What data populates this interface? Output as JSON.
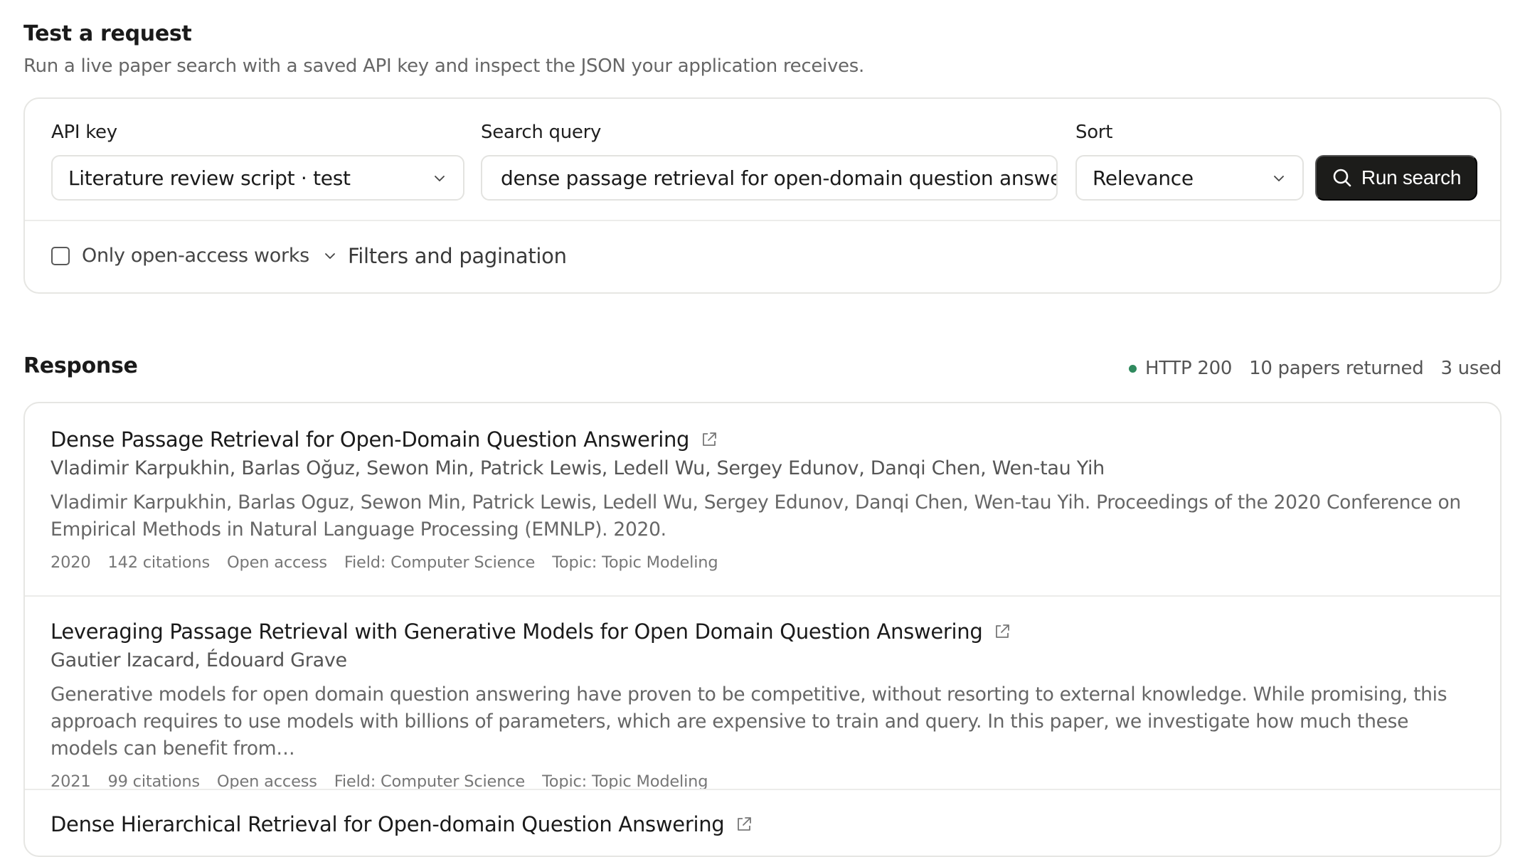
{
  "request": {
    "title": "Test a request",
    "subtitle": "Run a live paper search with a saved API key and inspect the JSON your application receives.",
    "api_key": {
      "label": "API key",
      "value": "Literature review script · test"
    },
    "query": {
      "label": "Search query",
      "value": "dense passage retrieval for open-domain question answering"
    },
    "sort": {
      "label": "Sort",
      "value": "Relevance"
    },
    "run_label": "Run search",
    "open_access_label": "Only open-access works",
    "open_access_checked": false,
    "filters_label": "Filters and pagination"
  },
  "response": {
    "title": "Response",
    "status": "HTTP 200",
    "returned": "10 papers returned",
    "used": "3 used",
    "status_color": "#2f8a5e",
    "results": [
      {
        "title": "Dense Passage Retrieval for Open-Domain Question Answering",
        "authors": "Vladimir Karpukhin, Barlas Oğuz, Sewon Min, Patrick Lewis, Ledell Wu, Sergey Edunov, Danqi Chen, Wen-tau Yih",
        "abstract": "Vladimir Karpukhin, Barlas Oguz, Sewon Min, Patrick Lewis, Ledell Wu, Sergey Edunov, Danqi Chen, Wen-tau Yih. Proceedings of the 2020 Conference on Empirical Methods in Natural Language Processing (EMNLP). 2020.",
        "year": "2020",
        "citations": "142 citations",
        "access": "Open access",
        "field": "Field: Computer Science",
        "topic": "Topic: Topic Modeling"
      },
      {
        "title": "Leveraging Passage Retrieval with Generative Models for Open Domain Question Answering",
        "authors": "Gautier Izacard, Édouard Grave",
        "abstract": "Generative models for open domain question answering have proven to be competitive, without resorting to external knowledge. While promising, this approach requires to use models with billions of parameters, which are expensive to train and query. In this paper, we investigate how much these models can benefit from…",
        "year": "2021",
        "citations": "99 citations",
        "access": "Open access",
        "field": "Field: Computer Science",
        "topic": "Topic: Topic Modeling"
      },
      {
        "title": "Dense Hierarchical Retrieval for Open-domain Question Answering"
      }
    ]
  }
}
